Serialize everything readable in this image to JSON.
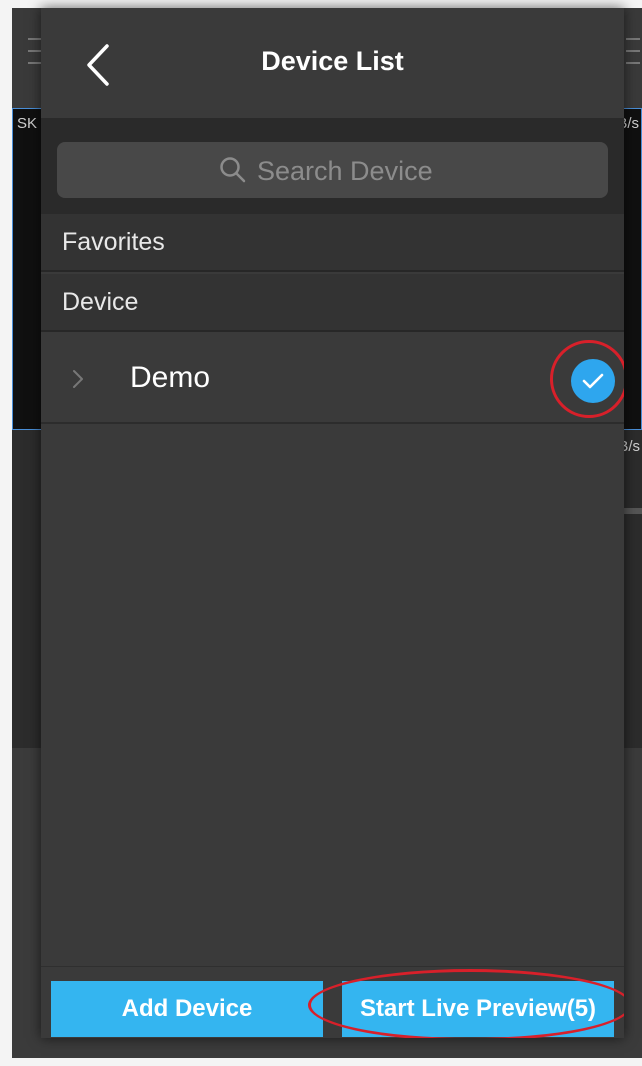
{
  "background": {
    "video_label": "SK",
    "speed_label_top": "B/s",
    "speed_label_mid": "B/s"
  },
  "header": {
    "title": "Device List",
    "back_icon": "chevron-left-icon"
  },
  "search": {
    "placeholder": "Search Device",
    "value": ""
  },
  "sections": {
    "favorites_label": "Favorites",
    "device_label": "Device"
  },
  "devices": [
    {
      "name": "Demo",
      "selected": true
    }
  ],
  "footer": {
    "add_device_label": "Add Device",
    "start_preview_label": "Start Live Preview(5)"
  },
  "colors": {
    "accent": "#34b5f0",
    "check": "#2ea6ee",
    "panel": "#3a3a3a",
    "annotation": "#d8202a"
  }
}
